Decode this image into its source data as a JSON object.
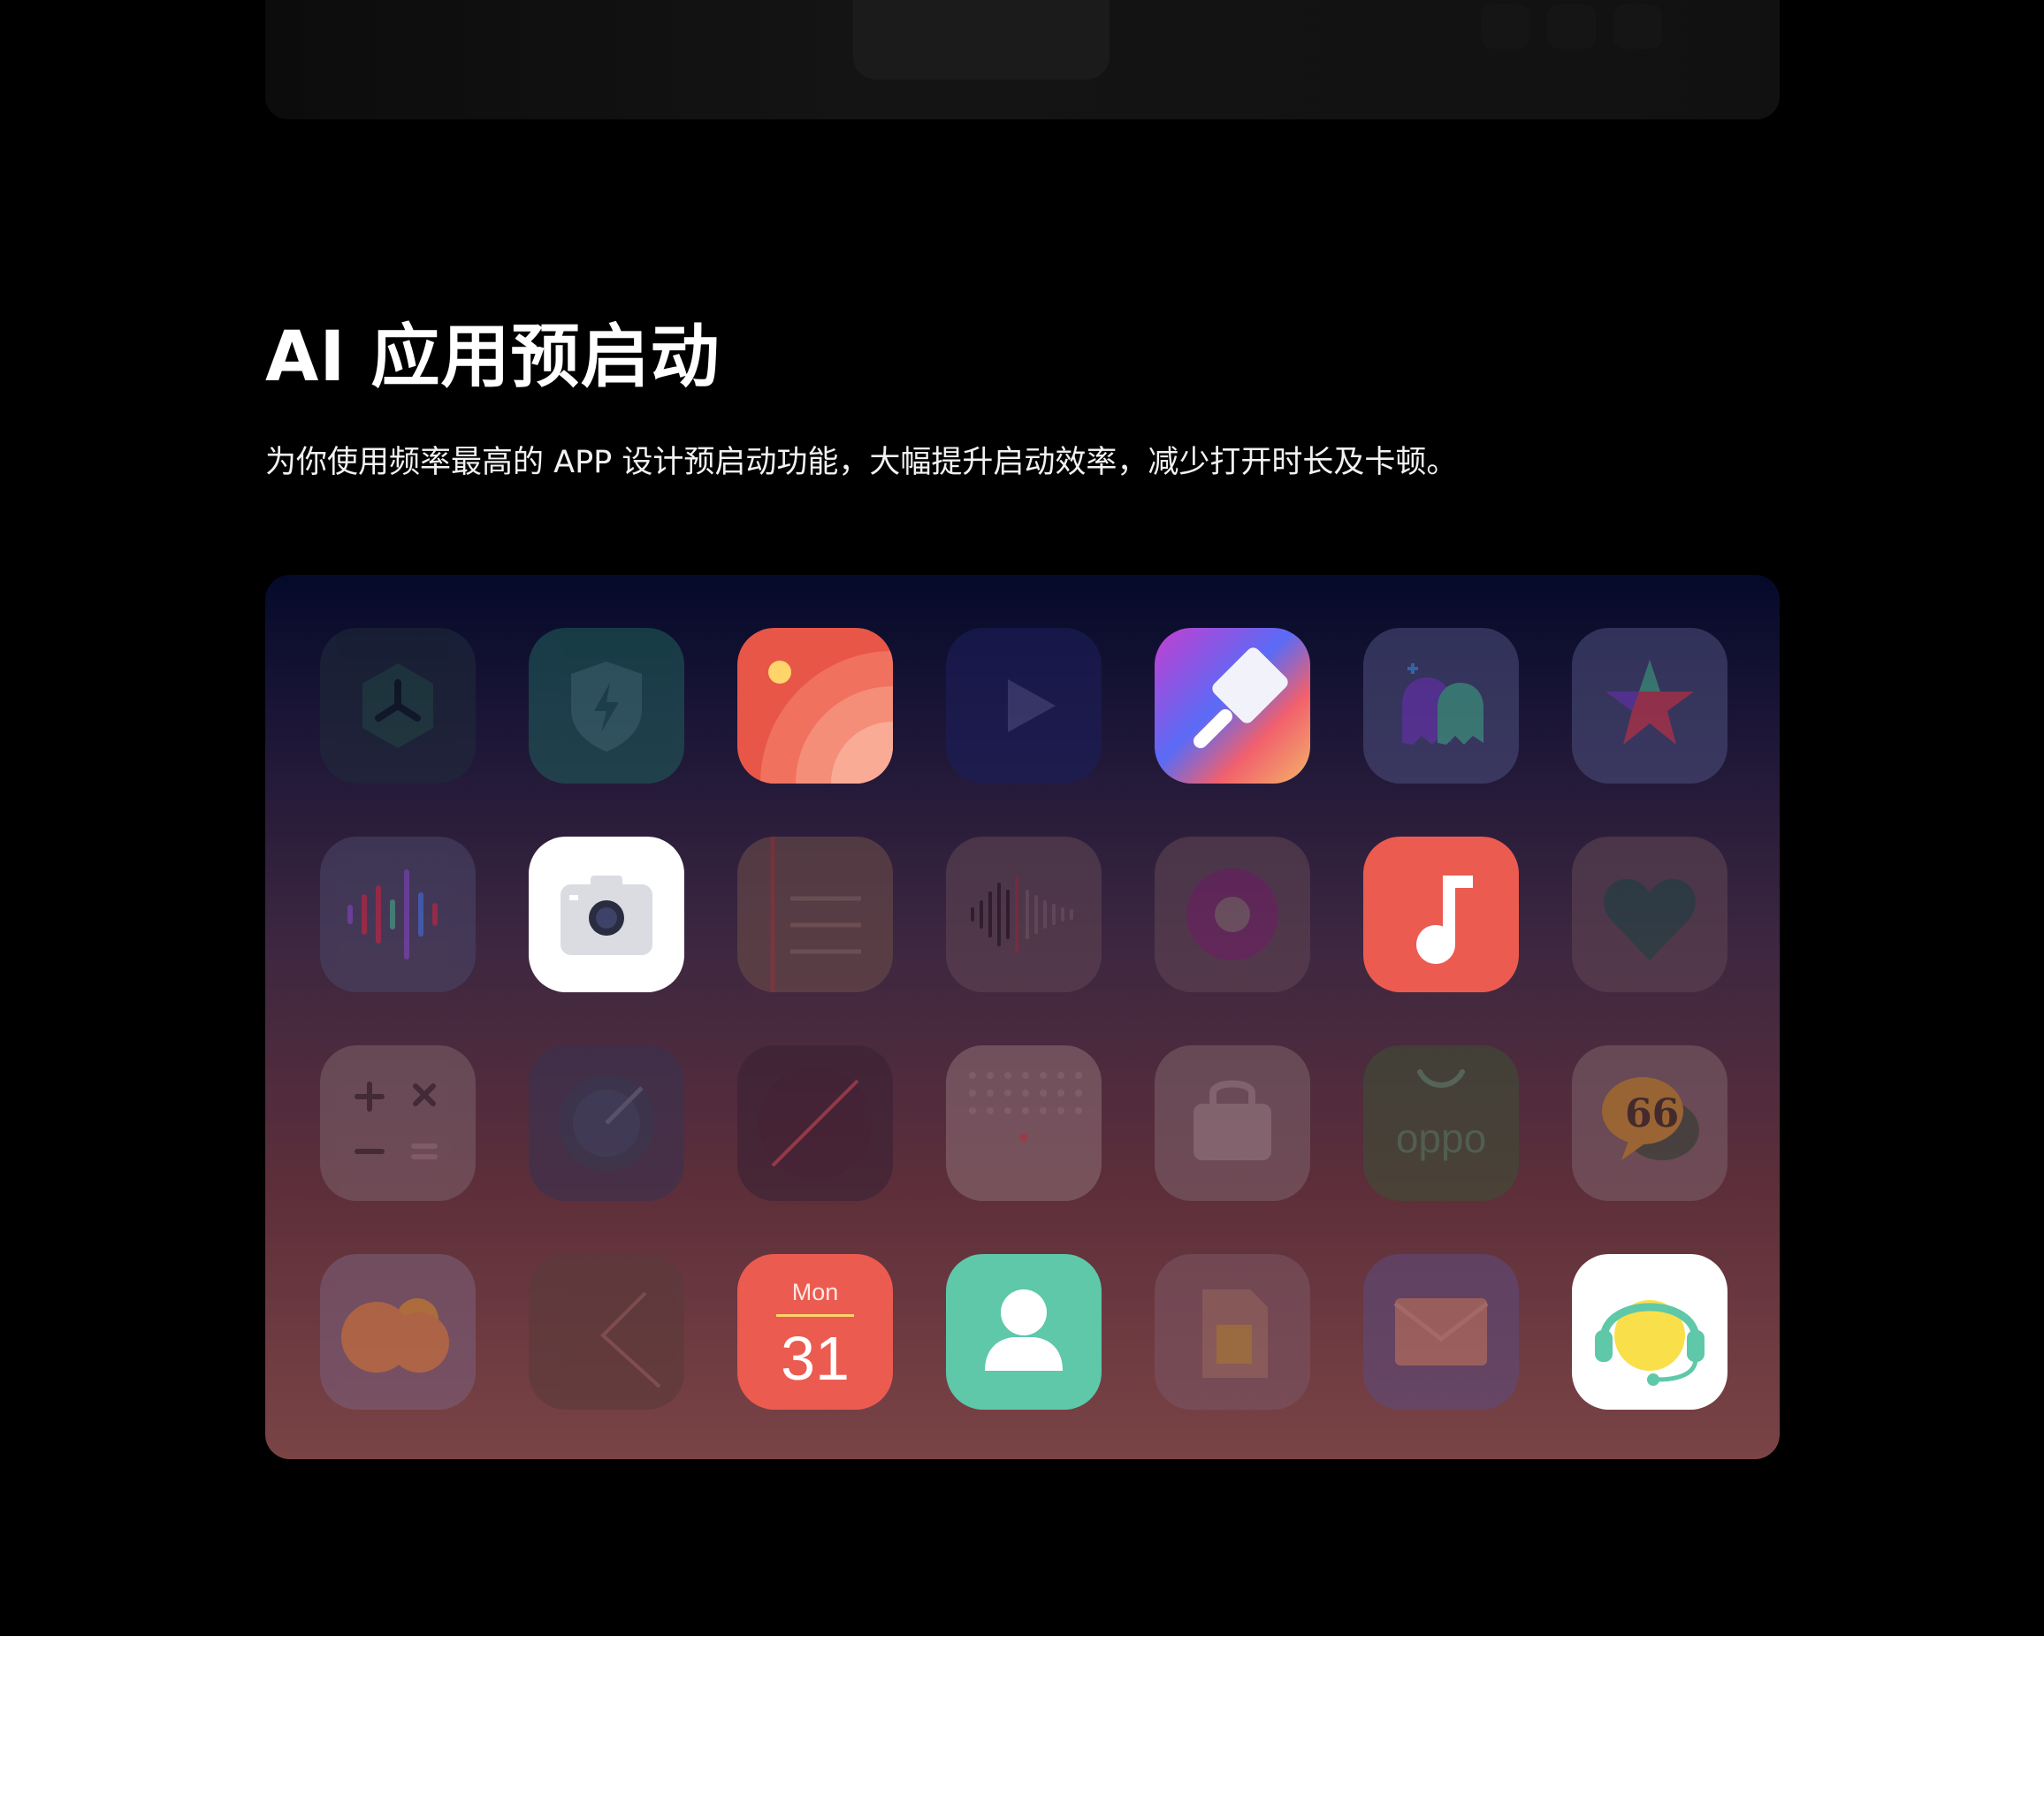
{
  "section": {
    "title": "AI 应用预启动",
    "description": "为你使用频率最高的 APP 设计预启动功能，大幅提升启动效率，减少打开时长及卡顿。"
  },
  "apps": [
    {
      "icon": "hexagon-fan-icon",
      "state": "dimmed"
    },
    {
      "icon": "shield-bolt-icon",
      "state": "dimmed"
    },
    {
      "icon": "gallery-icon",
      "state": "highlighted"
    },
    {
      "icon": "video-play-icon",
      "state": "dimmed"
    },
    {
      "icon": "theme-brush-icon",
      "state": "highlighted"
    },
    {
      "icon": "game-ghost-icon",
      "state": "dimmed"
    },
    {
      "icon": "star-icon",
      "state": "dimmed"
    },
    {
      "icon": "voice-wave-icon",
      "state": "dimmed"
    },
    {
      "icon": "camera-icon",
      "state": "highlighted"
    },
    {
      "icon": "notes-icon",
      "state": "dimmed"
    },
    {
      "icon": "recorder-icon",
      "state": "dimmed"
    },
    {
      "icon": "music-disc-icon",
      "state": "dimmed"
    },
    {
      "icon": "music-note-icon",
      "state": "highlighted"
    },
    {
      "icon": "heart-health-icon",
      "state": "dimmed"
    },
    {
      "icon": "calculator-icon",
      "state": "dimmed"
    },
    {
      "icon": "compass-icon",
      "state": "dimmed"
    },
    {
      "icon": "clock-icon",
      "state": "dimmed"
    },
    {
      "icon": "phone-dialpad-icon",
      "state": "dimmed"
    },
    {
      "icon": "store-bag-icon",
      "state": "dimmed"
    },
    {
      "icon": "oppo-shop-icon",
      "state": "dimmed",
      "label": "oppo"
    },
    {
      "icon": "community-chat-icon",
      "state": "dimmed"
    },
    {
      "icon": "weather-icon",
      "state": "dimmed"
    },
    {
      "icon": "back-arrow-icon",
      "state": "dimmed"
    },
    {
      "icon": "calendar-icon",
      "state": "highlighted",
      "day_label": "Mon",
      "date_number": "31"
    },
    {
      "icon": "contacts-icon",
      "state": "highlighted"
    },
    {
      "icon": "sim-card-icon",
      "state": "dimmed"
    },
    {
      "icon": "mail-icon",
      "state": "dimmed"
    },
    {
      "icon": "customer-service-icon",
      "state": "highlighted"
    }
  ],
  "colors": {
    "background": "#000000",
    "title": "#ffffff",
    "highlight_red": "#ec5b50",
    "highlight_green": "#5ec8a9"
  }
}
